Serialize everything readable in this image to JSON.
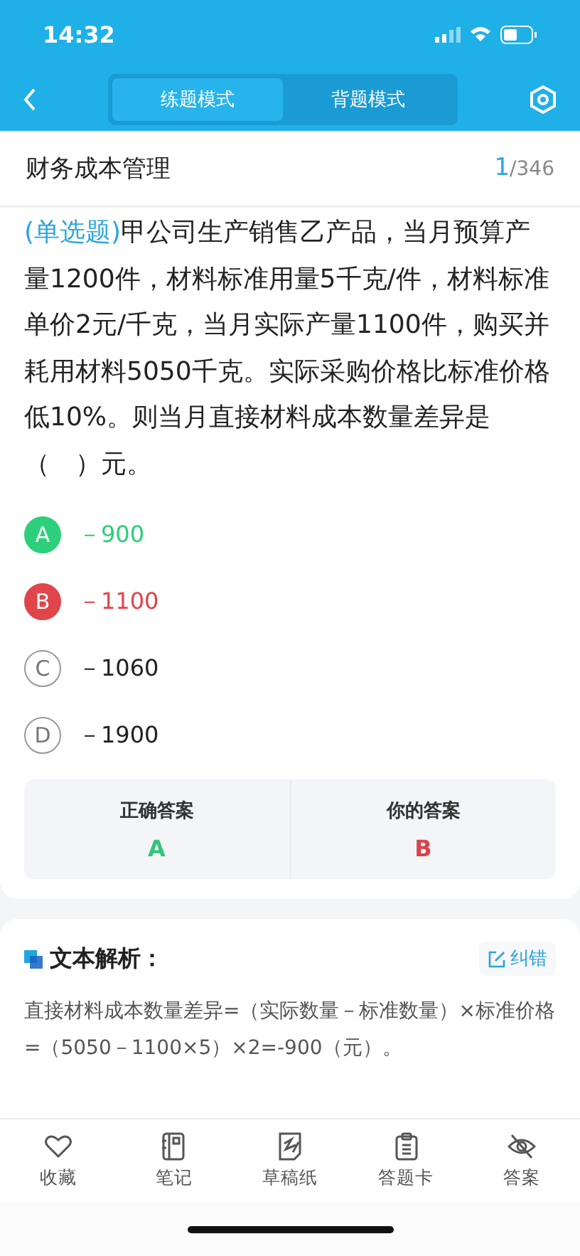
{
  "status_bar": {
    "time": "14:32"
  },
  "nav": {
    "tabs": [
      {
        "label": "练题模式",
        "selected": true
      },
      {
        "label": "背题模式",
        "selected": false
      }
    ]
  },
  "header": {
    "title": "财务成本管理",
    "current": "1",
    "total": "/346"
  },
  "question": {
    "type_tag": "(单选题)",
    "text": "甲公司生产销售乙产品，当月预算产量1200件，材料标准用量5千克/件，材料标准单价2元/千克，当月实际产量1100件，购买并耗用材料5050千克。实际采购价格比标准价格低10%。则当月直接材料成本数量差异是（　）元。"
  },
  "options": [
    {
      "letter": "A",
      "text": "－900",
      "kind": "correct"
    },
    {
      "letter": "B",
      "text": "－1100",
      "kind": "wrong"
    },
    {
      "letter": "C",
      "text": "－1060",
      "kind": "plain"
    },
    {
      "letter": "D",
      "text": "－1900",
      "kind": "plain"
    }
  ],
  "answers": [
    {
      "label": "正确答案",
      "value": "A",
      "kind": "correct"
    },
    {
      "label": "你的答案",
      "value": "B",
      "kind": "wrong"
    }
  ],
  "analysis": {
    "title": "文本解析：",
    "report_button": "纠错",
    "text": "直接材料成本数量差异=（实际数量－标准数量）×标准价格=（5050－1100×5）×2=-900（元）。"
  },
  "toolbar": [
    {
      "label": "收藏",
      "kind": "heart"
    },
    {
      "label": "笔记",
      "kind": "notebook"
    },
    {
      "label": "草稿纸",
      "kind": "draft"
    },
    {
      "label": "答题卡",
      "kind": "clipboard"
    },
    {
      "label": "答案",
      "kind": "eye"
    }
  ]
}
